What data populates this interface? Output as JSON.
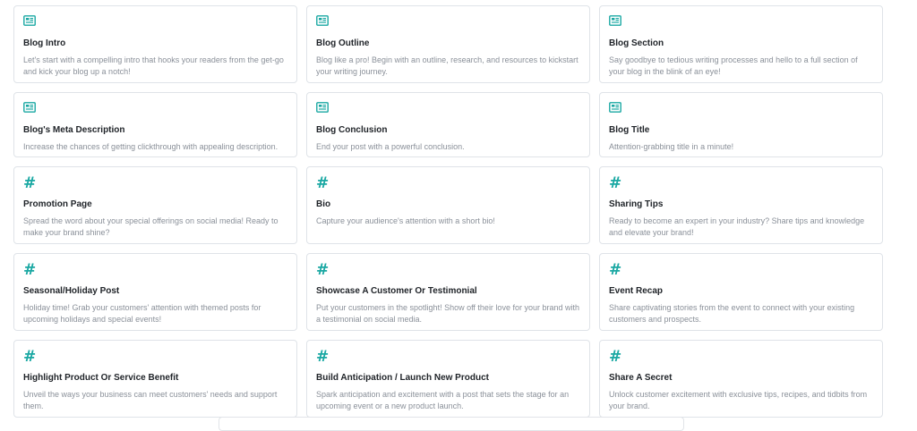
{
  "cards": [
    {
      "icon": "newspaper-icon",
      "title": "Blog Intro",
      "desc": "Let's start with a compelling intro that hooks your readers from the get-go and kick your blog up a notch!"
    },
    {
      "icon": "newspaper-icon",
      "title": "Blog Outline",
      "desc": "Blog like a pro! Begin with an outline, research, and resources to kickstart your writing journey."
    },
    {
      "icon": "newspaper-icon",
      "title": "Blog Section",
      "desc": "Say goodbye to tedious writing processes and hello to a full section of your blog in the blink of an eye!"
    },
    {
      "icon": "newspaper-icon",
      "title": "Blog's Meta Description",
      "desc": "Increase the chances of getting clickthrough with appealing description."
    },
    {
      "icon": "newspaper-icon",
      "title": "Blog Conclusion",
      "desc": "End your post with a powerful conclusion."
    },
    {
      "icon": "newspaper-icon",
      "title": "Blog Title",
      "desc": "Attention-grabbing title in a minute!"
    },
    {
      "icon": "hashtag-icon",
      "title": "Promotion Page",
      "desc": "Spread the word about your special offerings on social media! Ready to make your brand shine?"
    },
    {
      "icon": "hashtag-icon",
      "title": "Bio",
      "desc": "Capture your audience's attention with a short bio!"
    },
    {
      "icon": "hashtag-icon",
      "title": "Sharing Tips",
      "desc": "Ready to become an expert in your industry? Share tips and knowledge and elevate your brand!"
    },
    {
      "icon": "hashtag-icon",
      "title": "Seasonal/Holiday Post",
      "desc": "Holiday time! Grab your customers' attention with themed posts for upcoming holidays and special events!"
    },
    {
      "icon": "hashtag-icon",
      "title": "Showcase A Customer Or Testimonial",
      "desc": "Put your customers in the spotlight! Show off their love for your brand with a testimonial on social media."
    },
    {
      "icon": "hashtag-icon",
      "title": "Event Recap",
      "desc": "Share captivating stories from the event to connect with your existing customers and prospects."
    },
    {
      "icon": "hashtag-icon",
      "title": "Highlight Product Or Service Benefit",
      "desc": "Unveil the ways your business can meet customers' needs and support them."
    },
    {
      "icon": "hashtag-icon",
      "title": "Build Anticipation / Launch New Product",
      "desc": "Spark anticipation and excitement with a post that sets the stage for an upcoming event or a new product launch."
    },
    {
      "icon": "hashtag-icon",
      "title": "Share A Secret",
      "desc": "Unlock customer excitement with exclusive tips, recipes, and tidbits from your brand."
    }
  ],
  "colors": {
    "accent": "#1aa8a3",
    "title": "#1f2328",
    "desc": "#8a9099",
    "border": "#dfe3e8"
  }
}
